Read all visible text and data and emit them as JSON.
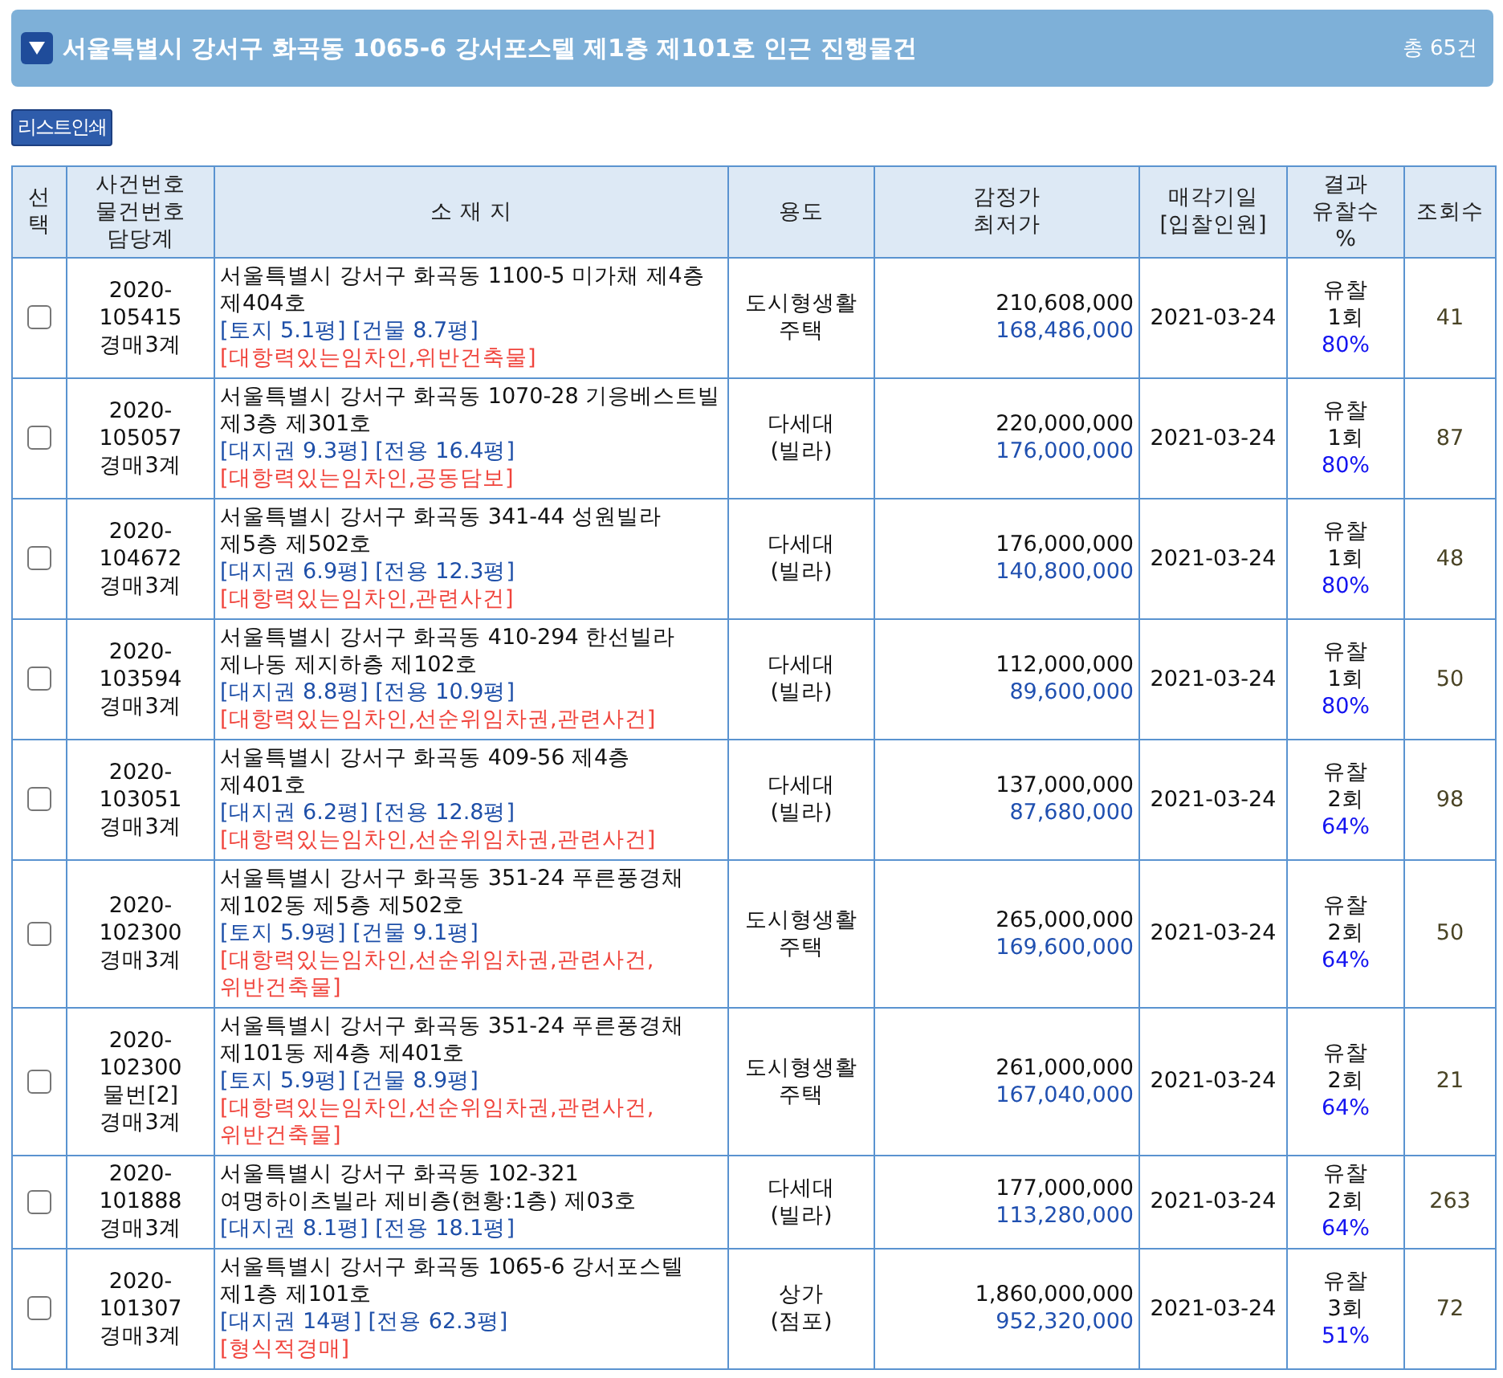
{
  "header": {
    "title": "서울특별시 강서구 화곡동 1065-6 강서포스텔 제1층 제101호 인근 진행물건",
    "total": "총 65건"
  },
  "print_button": "리스트인쇄",
  "table": {
    "columns": [
      [
        "선",
        "택"
      ],
      [
        "사건번호",
        "물건번호",
        "담당계"
      ],
      [
        "소 재 지"
      ],
      [
        "용도"
      ],
      [
        "감정가",
        "최저가"
      ],
      [
        "매각기일",
        "[입찰인원]"
      ],
      [
        "결과",
        "유찰수",
        "%"
      ],
      [
        "조회수"
      ]
    ],
    "rows": [
      {
        "checked": false,
        "case": [
          "2020-",
          "105415",
          "경매3계"
        ],
        "address": "서울특별시 강서구 화곡동 1100-5 미가채 제4층 제404호",
        "area": "[토지 5.1평] [건물 8.7평]",
        "notes": "[대항력있는임차인,위반건축물]",
        "use": [
          "도시형생활",
          "주택"
        ],
        "appraisal": "210,608,000",
        "minimum": "168,486,000",
        "date": "2021-03-24",
        "result": "유찰",
        "fails": "1회",
        "percent": "80%",
        "views": "41"
      },
      {
        "checked": false,
        "case": [
          "2020-",
          "105057",
          "경매3계"
        ],
        "address": "서울특별시 강서구 화곡동 1070-28 기응베스트빌 제3층 제301호",
        "area": "[대지권 9.3평] [전용 16.4평]",
        "notes": "[대항력있는임차인,공동담보]",
        "use": [
          "다세대",
          "(빌라)"
        ],
        "appraisal": "220,000,000",
        "minimum": "176,000,000",
        "date": "2021-03-24",
        "result": "유찰",
        "fails": "1회",
        "percent": "80%",
        "views": "87"
      },
      {
        "checked": false,
        "case": [
          "2020-",
          "104672",
          "경매3계"
        ],
        "address": "서울특별시 강서구 화곡동 341-44 성원빌라 제5층 제502호",
        "area": "[대지권 6.9평] [전용 12.3평]",
        "notes": "[대항력있는임차인,관련사건]",
        "use": [
          "다세대",
          "(빌라)"
        ],
        "appraisal": "176,000,000",
        "minimum": "140,800,000",
        "date": "2021-03-24",
        "result": "유찰",
        "fails": "1회",
        "percent": "80%",
        "views": "48"
      },
      {
        "checked": false,
        "case": [
          "2020-",
          "103594",
          "경매3계"
        ],
        "address": "서울특별시 강서구 화곡동 410-294 한선빌라 제나동 제지하층 제102호",
        "area": "[대지권 8.8평] [전용 10.9평]",
        "notes": "[대항력있는임차인,선순위임차권,관련사건]",
        "use": [
          "다세대",
          "(빌라)"
        ],
        "appraisal": "112,000,000",
        "minimum": "89,600,000",
        "date": "2021-03-24",
        "result": "유찰",
        "fails": "1회",
        "percent": "80%",
        "views": "50"
      },
      {
        "checked": false,
        "case": [
          "2020-",
          "103051",
          "경매3계"
        ],
        "address": "서울특별시 강서구 화곡동 409-56 제4층 제401호",
        "area": "[대지권 6.2평] [전용 12.8평]",
        "notes": "[대항력있는임차인,선순위임차권,관련사건]",
        "use": [
          "다세대",
          "(빌라)"
        ],
        "appraisal": "137,000,000",
        "minimum": "87,680,000",
        "date": "2021-03-24",
        "result": "유찰",
        "fails": "2회",
        "percent": "64%",
        "views": "98"
      },
      {
        "checked": false,
        "case": [
          "2020-",
          "102300",
          "경매3계"
        ],
        "address": "서울특별시 강서구 화곡동 351-24 푸른풍경채 제102동 제5층 제502호",
        "area": "[토지 5.9평] [건물 9.1평]",
        "notes": "[대항력있는임차인,선순위임차권,관련사건,위반건축물]",
        "use": [
          "도시형생활",
          "주택"
        ],
        "appraisal": "265,000,000",
        "minimum": "169,600,000",
        "date": "2021-03-24",
        "result": "유찰",
        "fails": "2회",
        "percent": "64%",
        "views": "50"
      },
      {
        "checked": false,
        "case": [
          "2020-",
          "102300",
          "물번[2]",
          "경매3계"
        ],
        "address": "서울특별시 강서구 화곡동 351-24 푸른풍경채 제101동 제4층 제401호",
        "area": "[토지 5.9평] [건물 8.9평]",
        "notes": "[대항력있는임차인,선순위임차권,관련사건,위반건축물]",
        "use": [
          "도시형생활",
          "주택"
        ],
        "appraisal": "261,000,000",
        "minimum": "167,040,000",
        "date": "2021-03-24",
        "result": "유찰",
        "fails": "2회",
        "percent": "64%",
        "views": "21"
      },
      {
        "checked": false,
        "case": [
          "2020-",
          "101888",
          "경매3계"
        ],
        "address": "서울특별시 강서구 화곡동 102-321 여명하이츠빌라 제비층(현황:1층) 제03호",
        "area": "[대지권 8.1평] [전용 18.1평]",
        "use": [
          "다세대",
          "(빌라)"
        ],
        "appraisal": "177,000,000",
        "minimum": "113,280,000",
        "date": "2021-03-24",
        "result": "유찰",
        "fails": "2회",
        "percent": "64%",
        "views": "263"
      },
      {
        "checked": false,
        "case": [
          "2020-",
          "101307",
          "경매3계"
        ],
        "address": "서울특별시 강서구 화곡동 1065-6 강서포스텔 제1층 제101호",
        "area": "[대지권 14평] [전용 62.3평]",
        "notes": "[형식적경매]",
        "use": [
          "상가",
          "(점포)"
        ],
        "appraisal": "1,860,000,000",
        "minimum": "952,320,000",
        "date": "2021-03-24",
        "result": "유찰",
        "fails": "3회",
        "percent": "51%",
        "views": "72"
      }
    ]
  }
}
